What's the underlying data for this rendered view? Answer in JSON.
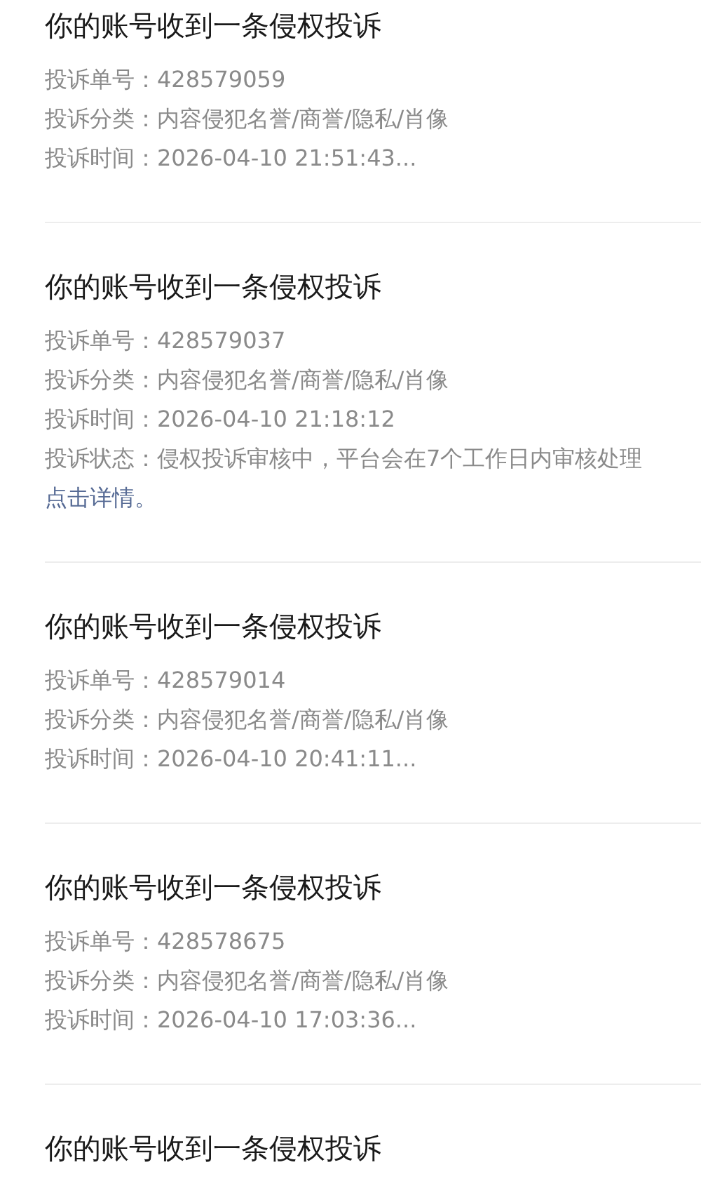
{
  "complaints": [
    {
      "title": "你的账号收到一条侵权投诉",
      "fields": [
        {
          "label": "投诉单号：",
          "value": "428579059"
        },
        {
          "label": "投诉分类：",
          "value": "内容侵犯名誉/商誉/隐私/肖像"
        },
        {
          "label": "投诉时间：",
          "value": "2026-04-10 21:51:43..."
        }
      ]
    },
    {
      "title": "你的账号收到一条侵权投诉",
      "fields": [
        {
          "label": "投诉单号：",
          "value": "428579037"
        },
        {
          "label": "投诉分类：",
          "value": "内容侵犯名誉/商誉/隐私/肖像"
        },
        {
          "label": "投诉时间：",
          "value": "2026-04-10 21:18:12"
        },
        {
          "label": "投诉状态：",
          "value": "侵权投诉审核中，平台会在7个工作日内审核处理"
        }
      ],
      "link": "点击详情。"
    },
    {
      "title": "你的账号收到一条侵权投诉",
      "fields": [
        {
          "label": "投诉单号：",
          "value": "428579014"
        },
        {
          "label": "投诉分类：",
          "value": "内容侵犯名誉/商誉/隐私/肖像"
        },
        {
          "label": "投诉时间：",
          "value": "2026-04-10 20:41:11..."
        }
      ]
    },
    {
      "title": "你的账号收到一条侵权投诉",
      "fields": [
        {
          "label": "投诉单号：",
          "value": "428578675"
        },
        {
          "label": "投诉分类：",
          "value": "内容侵犯名誉/商誉/隐私/肖像"
        },
        {
          "label": "投诉时间：",
          "value": "2026-04-10 17:03:36..."
        }
      ]
    },
    {
      "title": "你的账号收到一条侵权投诉"
    }
  ]
}
